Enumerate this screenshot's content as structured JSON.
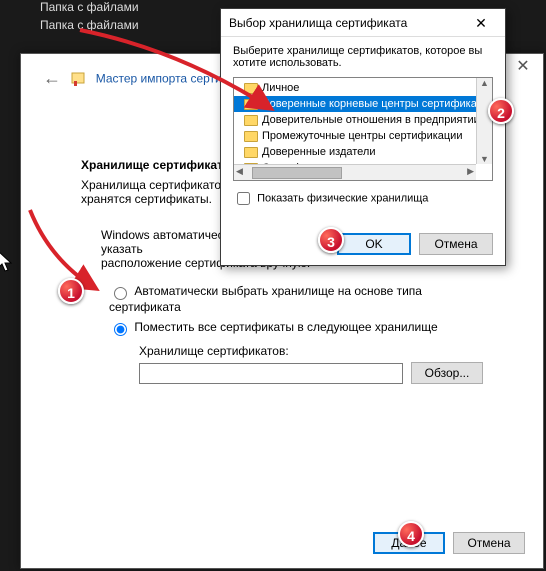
{
  "background": {
    "rows": [
      "Папка с файлами",
      "Папка с файлами"
    ]
  },
  "wizard": {
    "back_arrow": "←",
    "title": "Мастер импорта сертификатов",
    "section_heading": "Хранилище сертификатов",
    "section_desc_1": "Хранилища сертификатов - это системные области, в которых",
    "section_desc_2": "хранятся сертификаты.",
    "auto_line_1": "Windows автоматически выберет хранилище, или вы можете указать",
    "auto_line_2": "расположение сертификата вручную.",
    "radio_auto": "Автоматически выбрать хранилище на основе типа сертификата",
    "radio_place": "Поместить все сертификаты в следующее хранилище",
    "store_label": "Хранилище сертификатов:",
    "store_value": "",
    "browse": "Обзор...",
    "next": "Далее",
    "cancel": "Отмена"
  },
  "modal": {
    "title": "Выбор хранилища сертификата",
    "close": "✕",
    "instruction": "Выберите хранилище сертификатов, которое вы хотите использовать.",
    "tree": [
      {
        "label": "Личное",
        "selected": false
      },
      {
        "label": "Доверенные корневые центры сертификации",
        "selected": true
      },
      {
        "label": "Доверительные отношения в предприятии",
        "selected": false
      },
      {
        "label": "Промежуточные центры сертификации",
        "selected": false
      },
      {
        "label": "Доверенные издатели",
        "selected": false
      },
      {
        "label": "Сертификаты, к которым нет доверия",
        "selected": false
      }
    ],
    "show_physical": "Показать физические хранилища",
    "ok": "OK",
    "cancel": "Отмена"
  },
  "markers": {
    "m1": "1",
    "m2": "2",
    "m3": "3",
    "m4": "4"
  }
}
